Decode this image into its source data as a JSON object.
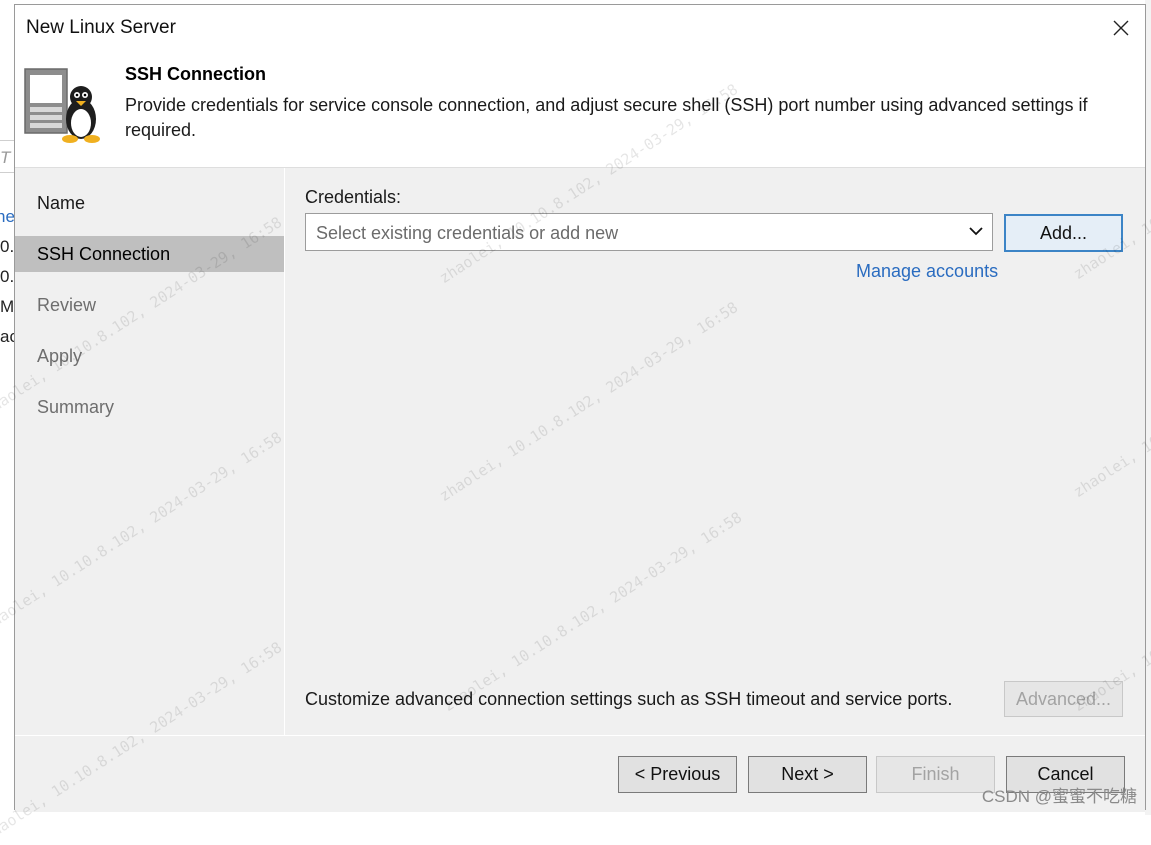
{
  "background": {
    "fragments": [
      "T",
      "ne",
      "0.",
      "0.",
      "M",
      "ac"
    ]
  },
  "dialog": {
    "title": "New Linux Server"
  },
  "header": {
    "title": "SSH Connection",
    "description": "Provide credentials for service console connection, and adjust secure shell (SSH) port number using advanced settings if required."
  },
  "nav": {
    "items": [
      {
        "label": "Name",
        "state": "normal"
      },
      {
        "label": "SSH Connection",
        "state": "active"
      },
      {
        "label": "Review",
        "state": "disabled"
      },
      {
        "label": "Apply",
        "state": "disabled"
      },
      {
        "label": "Summary",
        "state": "disabled"
      }
    ]
  },
  "credentials": {
    "label": "Credentials:",
    "placeholder": "Select existing credentials or add new",
    "add_button": "Add...",
    "manage_link": "Manage accounts"
  },
  "advanced": {
    "text": "Customize advanced connection settings such as SSH timeout and service ports.",
    "button": "Advanced..."
  },
  "footer": {
    "previous": "< Previous",
    "next": "Next >",
    "finish": "Finish",
    "cancel": "Cancel"
  },
  "watermark": {
    "text": "zhaolei, 10.10.8.102, 2024-03-29, 16:58"
  },
  "credit": "CSDN @蜜蜜不吃糖",
  "colors": {
    "accent": "#3c84c6",
    "link": "#2a6cc0",
    "active_nav": "#bfbfbf"
  }
}
